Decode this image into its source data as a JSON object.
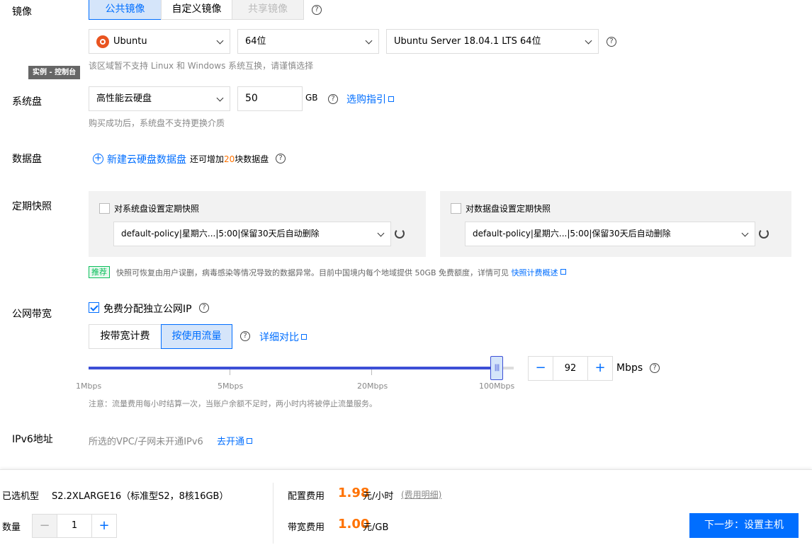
{
  "image": {
    "label": "镜像",
    "tabs": [
      {
        "label": "公共镜像",
        "state": "active"
      },
      {
        "label": "自定义镜像",
        "state": "normal"
      },
      {
        "label": "共享镜像",
        "state": "disabled"
      }
    ],
    "os_select": "Ubuntu",
    "bits_select": "64位",
    "version_select": "Ubuntu Server 18.04.1 LTS 64位",
    "tip": "该区域暂不支持 Linux 和 Windows 系统互换，请谨慎选择",
    "tooltip": "实例 - 控制台"
  },
  "system_disk": {
    "label": "系统盘",
    "type": "高性能云硬盘",
    "size": "50",
    "unit": "GB",
    "guide_link": "选购指引",
    "tip": "购买成功后，系统盘不支持更换介质"
  },
  "data_disk": {
    "label": "数据盘",
    "add_link": "新建云硬盘数据盘",
    "remain_prefix": "还可增加",
    "remain_count": "20",
    "remain_suffix": "块数据盘"
  },
  "snapshot": {
    "label": "定期快照",
    "system_checkbox": "对系统盘设置定期快照",
    "system_policy": "default-policy|星期六...|5:00|保留30天后自动删除",
    "data_checkbox": "对数据盘设置定期快照",
    "data_policy": "default-policy|星期六...|5:00|保留30天后自动删除",
    "badge": "推荐",
    "tip": "快照可恢复由用户误删，病毒感染等情况导致的数据异常。目前中国境内每个地域提供 50GB 免费额度，详情可见",
    "tip_link": "快照计费概述"
  },
  "bandwidth": {
    "label": "公网带宽",
    "free_ip_checkbox": "免费分配独立公网IP",
    "billing_tabs": [
      {
        "label": "按带宽计费",
        "state": "normal"
      },
      {
        "label": "按使用流量",
        "state": "active"
      }
    ],
    "compare_link": "详细对比",
    "slider_ticks": [
      "1Mbps",
      "5Mbps",
      "20Mbps",
      "100Mbps"
    ],
    "slider_fraction": 0.96,
    "value": "92",
    "unit": "Mbps",
    "minus": "−",
    "plus": "+",
    "note": "注意：流量费用每小时结算一次，当账户余额不足时，两小时内将被停止流量服务。"
  },
  "ipv6": {
    "label": "IPv6地址",
    "text": "所选的VPC/子网未开通IPv6",
    "link": "去开通"
  },
  "footer": {
    "model_label": "已选机型",
    "model_value": "S2.2XLARGE16（标准型S2，8核16GB）",
    "qty_label": "数量",
    "qty_value": "1",
    "qty_minus": "−",
    "qty_plus": "+",
    "config_fee_label": "配置费用",
    "config_fee_value": "1.98",
    "config_fee_unit": "元/小时",
    "fee_detail_link": "(费用明细)",
    "bw_fee_label": "带宽费用",
    "bw_fee_value": "1.00",
    "bw_fee_unit": "元/GB",
    "next_button": "下一步：设置主机"
  },
  "colors": {
    "accent": "#006eff",
    "price": "#ff7200",
    "recommend": "#0abf5b"
  }
}
